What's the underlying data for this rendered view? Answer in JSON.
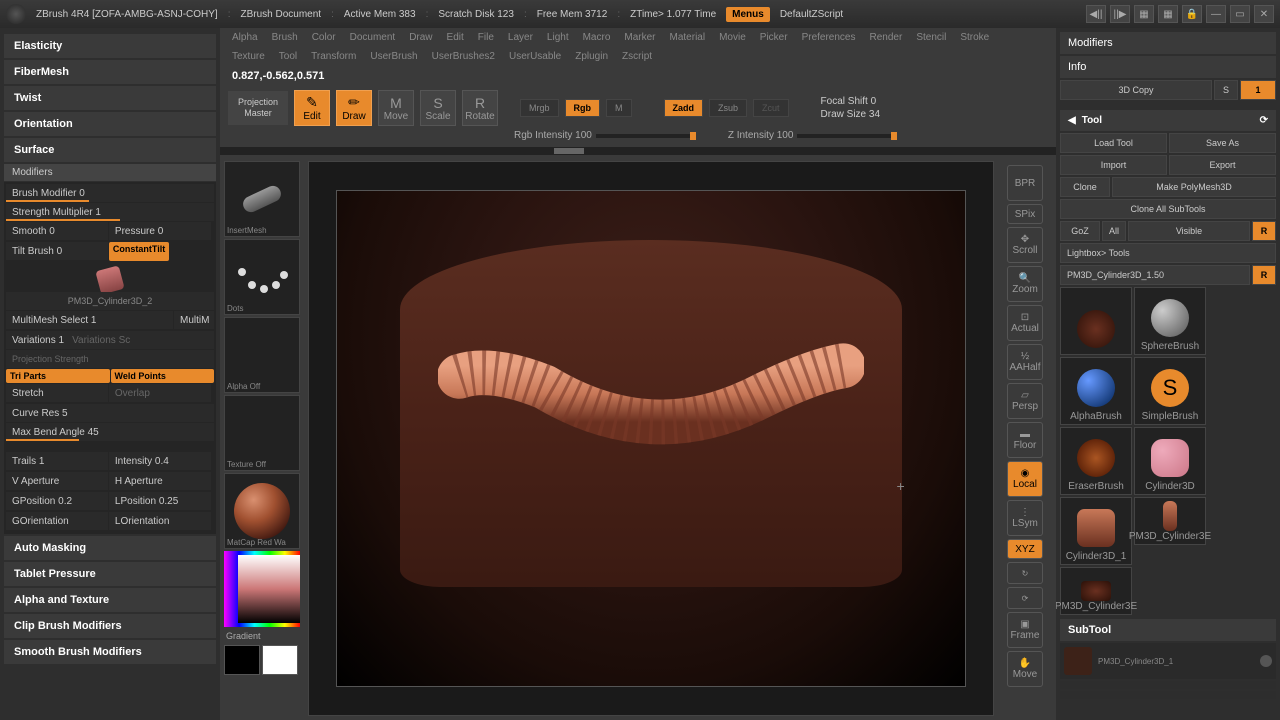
{
  "title": {
    "app": "ZBrush 4R4 [ZOFA-AMBG-ASNJ-COHY]",
    "doc": "ZBrush Document",
    "mem": "Active Mem 383",
    "scratch": "Scratch Disk 123",
    "free": "Free Mem 3712",
    "ztime": "ZTime> 1.077 Time",
    "menus": "Menus",
    "script": "DefaultZScript"
  },
  "left_menu": {
    "elasticity": "Elasticity",
    "fibermesh": "FiberMesh",
    "twist": "Twist",
    "orientation": "Orientation",
    "surface": "Surface"
  },
  "modifiers": {
    "header": "Modifiers",
    "brush_mod": "Brush Modifier 0",
    "strength": "Strength Multiplier 1",
    "smooth": "Smooth 0",
    "pressure": "Pressure 0",
    "tilt": "Tilt Brush 0",
    "const_tilt": "ConstantTilt",
    "pm3d": "PM3D_Cylinder3D_2",
    "multimesh": "MultiMesh Select 1",
    "multim": "MultiM",
    "variations": "Variations 1",
    "proj_str": "Projection Strength",
    "tri_parts": "Tri Parts",
    "weld": "Weld Points",
    "stretch": "Stretch",
    "overlap": "Overlap",
    "curve_res": "Curve Res 5",
    "max_bend": "Max Bend Angle 45",
    "trails": "Trails 1",
    "intensity": "Intensity 0.4",
    "vap": "V Aperture",
    "hap": "H Aperture",
    "gpos": "GPosition 0.2",
    "lpos": "LPosition 0.25",
    "gori": "GOrientation",
    "lori": "LOrientation"
  },
  "left_bottom": {
    "auto": "Auto Masking",
    "tablet": "Tablet Pressure",
    "alpha": "Alpha and Texture",
    "clip": "Clip Brush Modifiers",
    "smooth": "Smooth Brush Modifiers"
  },
  "top_menu": [
    "Alpha",
    "Brush",
    "Color",
    "Document",
    "Draw",
    "Edit",
    "File",
    "Layer",
    "Light",
    "Macro",
    "Marker",
    "Material",
    "Movie",
    "Picker",
    "Preferences",
    "Render",
    "Stencil",
    "Stroke"
  ],
  "top_menu2": [
    "Texture",
    "Tool",
    "Transform",
    "UserBrush",
    "UserBrushes2",
    "UserUsable",
    "Zplugin",
    "Zscript"
  ],
  "coords": "0.827,-0.562,0.571",
  "toolbar": {
    "proj": "Projection Master",
    "edit": "Edit",
    "draw": "Draw",
    "move": "Move",
    "scale": "Scale",
    "rotate": "Rotate",
    "mrgb": "Mrgb",
    "rgb": "Rgb",
    "m": "M",
    "zadd": "Zadd",
    "zsub": "Zsub",
    "zcut": "Zcut",
    "rgb_int": "Rgb Intensity 100",
    "z_int": "Z Intensity 100",
    "focal": "Focal Shift 0",
    "draw_size": "Draw Size 34"
  },
  "thumbs": {
    "insert": "InsertMesh",
    "dots": "Dots",
    "alpha": "Alpha Off",
    "texture": "Texture Off",
    "matcap": "MatCap Red Wa",
    "gradient": "Gradient"
  },
  "right_tools": {
    "bpr": "BPR",
    "spix": "SPix",
    "scroll": "Scroll",
    "zoom": "Zoom",
    "actual": "Actual",
    "aahalf": "AAHalf",
    "persp": "Persp",
    "floor": "Floor",
    "local": "Local",
    "lsym": "LSym",
    "xyz": "XYZ",
    "frame": "Frame",
    "move": "Move"
  },
  "right_panel": {
    "modifiers": "Modifiers",
    "info": "Info",
    "copy3d": "3D Copy",
    "s": "S",
    "one": "1",
    "tool": "Tool",
    "load": "Load Tool",
    "save": "Save As",
    "import": "Import",
    "export": "Export",
    "clone": "Clone",
    "make": "Make PolyMesh3D",
    "cloneall": "Clone All SubTools",
    "goz": "GoZ",
    "all": "All",
    "visible": "Visible",
    "r": "R",
    "lightbox": "Lightbox> Tools",
    "current": "PM3D_Cylinder3D_1.50",
    "r2": "R"
  },
  "brushes": {
    "sphere": "SphereBrush",
    "alpha": "AlphaBrush",
    "simple": "SimpleBrush",
    "eraser": "EraserBrush",
    "cyl": "Cylinder3D",
    "cyl1": "Cylinder3D_1",
    "pm1": "PM3D_Cylinder3E",
    "pm2": "PM3D_Cylinder3E"
  },
  "subtool": {
    "header": "SubTool",
    "item": "PM3D_Cylinder3D_1"
  }
}
